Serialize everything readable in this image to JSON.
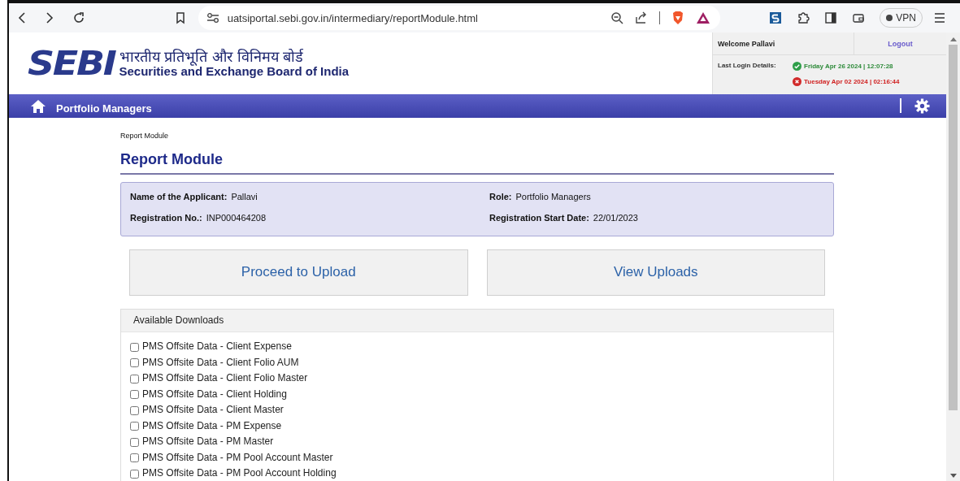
{
  "browser": {
    "url": "uatsiportal.sebi.gov.in/intermediary/reportModule.html",
    "vpn_label": "VPN"
  },
  "header": {
    "logo_text": "SEBI",
    "hindi_name": "भारतीय प्रतिभूति और विनिमय बोर्ड",
    "english_name": "Securities and Exchange Board of India"
  },
  "user_panel": {
    "welcome": "Welcome Pallavi",
    "logout": "Logout",
    "last_login_label": "Last Login Details:",
    "logins": [
      {
        "kind": "success",
        "text": "Friday Apr 26 2024 | 12:07:28"
      },
      {
        "kind": "failed",
        "text": "Tuesday Apr 02 2024 | 02:16:44"
      }
    ]
  },
  "nav": {
    "title": "Portfolio Managers"
  },
  "breadcrumb": "Report Module",
  "page_title": "Report Module",
  "applicant": [
    {
      "label": "Name of the Applicant:",
      "value": "Pallavi"
    },
    {
      "label": "Role:",
      "value": "Portfolio Managers"
    },
    {
      "label": "Registration No.:",
      "value": "INP000464208"
    },
    {
      "label": "Registration Start Date:",
      "value": "22/01/2023"
    }
  ],
  "actions": [
    "Proceed to Upload",
    "View Uploads"
  ],
  "downloads": {
    "title": "Available Downloads",
    "items": [
      {
        "label": "PMS Offsite Data - Client Expense",
        "checked": false
      },
      {
        "label": "PMS Offsite Data - Client Folio AUM",
        "checked": false
      },
      {
        "label": "PMS Offsite Data - Client Folio Master",
        "checked": false
      },
      {
        "label": "PMS Offsite Data - Client Holding",
        "checked": false
      },
      {
        "label": "PMS Offsite Data - Client Master",
        "checked": false
      },
      {
        "label": "PMS Offsite Data - PM Expense",
        "checked": false
      },
      {
        "label": "PMS Offsite Data - PM Master",
        "checked": false
      },
      {
        "label": "PMS Offsite Data - PM Pool Account Master",
        "checked": false
      },
      {
        "label": "PMS Offsite Data - PM Pool Account Holding",
        "checked": false
      }
    ]
  }
}
